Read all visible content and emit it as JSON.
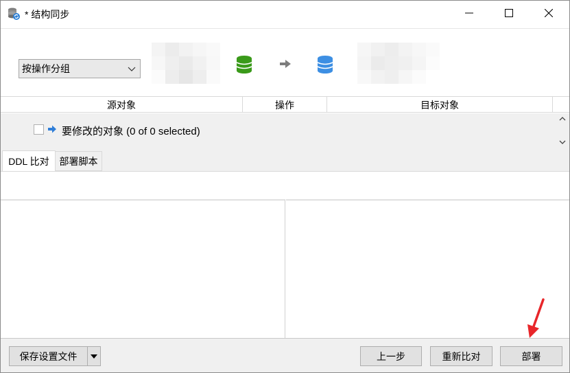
{
  "window": {
    "title": "* 结构同步",
    "controls": {
      "minimize": "minimize",
      "maximize": "maximize",
      "close": "close"
    }
  },
  "header": {
    "group_select": {
      "value": "按操作分组"
    },
    "source_db_color": "#3a9a1a",
    "target_db_color": "#3d8fe3"
  },
  "grid": {
    "columns": [
      "源对象",
      "操作",
      "目标对象"
    ],
    "rows": [
      {
        "label": "要修改的对象 (0 of 0 selected)",
        "checked": false
      }
    ]
  },
  "tabs": [
    {
      "label": "DDL 比对",
      "active": true
    },
    {
      "label": "部署脚本",
      "active": false
    }
  ],
  "footer": {
    "save_settings": "保存设置文件",
    "prev": "上一步",
    "recompare": "重新比对",
    "deploy": "部署"
  },
  "annotation": {
    "arrow_color": "#e8262a"
  }
}
